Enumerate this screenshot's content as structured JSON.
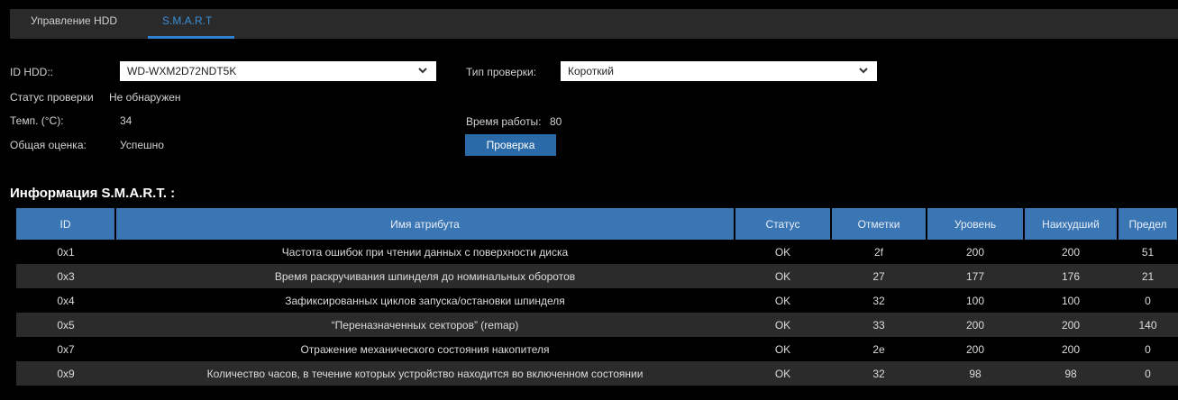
{
  "tabs": [
    {
      "label": "Управление HDD",
      "active": false
    },
    {
      "label": "S.M.A.R.T",
      "active": true
    }
  ],
  "form": {
    "hdd_id_label": "ID HDD::",
    "hdd_id_value": "WD-WXM2D72NDT5K",
    "check_type_label": "Тип проверки:",
    "check_type_value": "Короткий",
    "check_status_label": "Статус проверки",
    "check_status_value": "Не обнаружен",
    "temp_label": "Темп. (°C):",
    "temp_value": "34",
    "uptime_label": "Время работы:",
    "uptime_value": "80",
    "overall_label": "Общая оценка:",
    "overall_value": "Успешно",
    "check_button": "Проверка"
  },
  "smart_title": "Информация S.M.A.R.T. :",
  "table": {
    "headers": [
      "ID",
      "Имя атрибута",
      "Статус",
      "Отметки",
      "Уровень",
      "Наихудший",
      "Предел"
    ],
    "rows": [
      [
        "0x1",
        "Частота ошибок при чтении данных с поверхности диска",
        "OK",
        "2f",
        "200",
        "200",
        "51"
      ],
      [
        "0x3",
        "Время раскручивания шпинделя до номинальных оборотов",
        "OK",
        "27",
        "177",
        "176",
        "21"
      ],
      [
        "0x4",
        "Зафиксированных циклов запуска/остановки шпинделя",
        "OK",
        "32",
        "100",
        "100",
        "0"
      ],
      [
        "0x5",
        "“Переназначенных секторов” (remap)",
        "OK",
        "33",
        "200",
        "200",
        "140"
      ],
      [
        "0x7",
        "Отражение механического состояния накопителя",
        "OK",
        "2e",
        "200",
        "200",
        "0"
      ],
      [
        "0x9",
        "Количество часов, в течение которых устройство находится во включенном состоянии",
        "OK",
        "32",
        "98",
        "98",
        "0"
      ]
    ]
  },
  "colors": {
    "tab_active": "#3a8fd6",
    "header_bg": "#3a75b4",
    "button_bg": "#2a6aa8"
  },
  "icons": {
    "dropdown": "chevron-down-icon"
  }
}
